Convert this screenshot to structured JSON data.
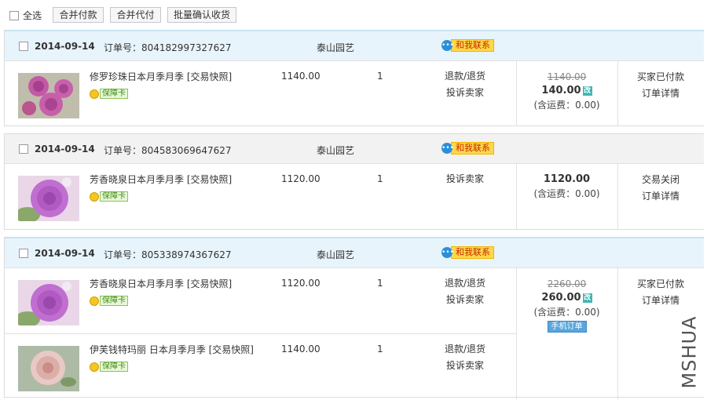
{
  "toolbar": {
    "select_all_label": "全选",
    "merge_pay_label": "合并付款",
    "merge_proxy_label": "合并代付",
    "batch_confirm_label": "批量确认收货"
  },
  "labels": {
    "order_no_prefix": "订单号：",
    "contact_label": "和我联系",
    "guarantee_label": "保障卡",
    "complain": "投诉卖家",
    "refund": "退款/退货",
    "shipping_prefix": "(含运费：",
    "shipping_suffix": ")",
    "order_detail": "订单详情",
    "mobile_order": "手机订单"
  },
  "orders": [
    {
      "date": "2014-09-14",
      "order_label": "订单号：804182997327627",
      "shop": "泰山园艺",
      "items": [
        {
          "name": "修罗珍珠日本月季月季 [交易快照]",
          "price": "1140.00",
          "qty": "1",
          "actions": [
            "退款/退货",
            "投诉卖家"
          ],
          "image": "pink-rose-cluster"
        }
      ],
      "original_total": "1140.00",
      "total": "140.00",
      "edited_badge": "改",
      "shipping": "(含运费：0.00)",
      "status": "买家已付款",
      "detail": "订单详情"
    },
    {
      "date": "2014-09-14",
      "order_label": "订单号：804583069647627",
      "shop": "泰山园艺",
      "items": [
        {
          "name": "芳香晓泉日本月季月季 [交易快照]",
          "price": "1120.00",
          "qty": "1",
          "actions": [
            "投诉卖家"
          ],
          "image": "lilac-rose"
        }
      ],
      "total": "1120.00",
      "shipping": "(含运费：0.00)",
      "status": "交易关闭",
      "detail": "订单详情"
    },
    {
      "date": "2014-09-14",
      "order_label": "订单号：805338974367627",
      "shop": "泰山园艺",
      "items": [
        {
          "name": "芳香晓泉日本月季月季 [交易快照]",
          "price": "1120.00",
          "qty": "1",
          "actions": [
            "退款/退货",
            "投诉卖家"
          ],
          "image": "lilac-rose"
        },
        {
          "name": "伊芙钱特玛丽 日本月季月季 [交易快照]",
          "price": "1140.00",
          "qty": "1",
          "actions": [
            "退款/退货",
            "投诉卖家"
          ],
          "image": "pale-pink-rose"
        }
      ],
      "original_total": "2260.00",
      "total": "260.00",
      "edited_badge": "改",
      "shipping": "(含运费：0.00)",
      "mobile_tag": "手机订单",
      "status": "买家已付款",
      "detail": "订单详情"
    }
  ],
  "watermark": "MSHUA",
  "colors": {
    "header_blue": "#e8f4fb",
    "header_grey": "#f2f2f2",
    "contact_badge": "#ffd84a",
    "guarantee_green": "#3d8d12",
    "edit_badge": "#3cb7b4",
    "mobile_tag": "#5aa6dc"
  }
}
